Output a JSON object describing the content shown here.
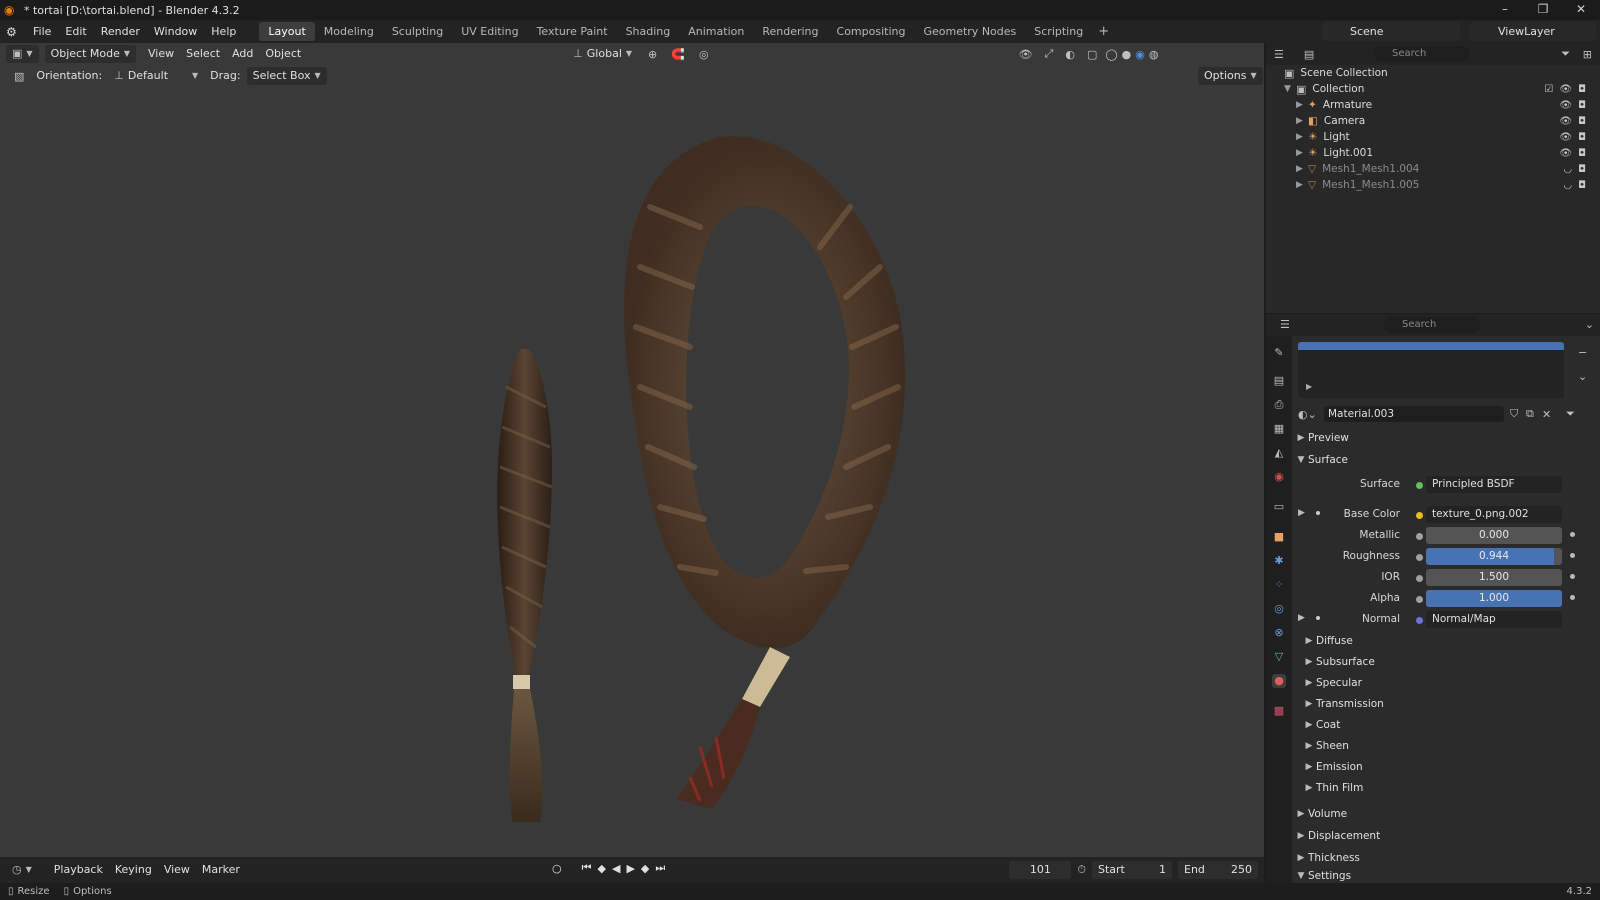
{
  "window": {
    "title": "* tortai [D:\\tortai.blend] - Blender 4.3.2",
    "minimize": "–",
    "maximize": "❐",
    "close": "✕"
  },
  "menu": [
    "File",
    "Edit",
    "Render",
    "Window",
    "Help"
  ],
  "workspaces": {
    "tabs": [
      "Layout",
      "Modeling",
      "Sculpting",
      "UV Editing",
      "Texture Paint",
      "Shading",
      "Animation",
      "Rendering",
      "Compositing",
      "Geometry Nodes",
      "Scripting"
    ],
    "active": "Layout",
    "add": "+"
  },
  "scene": {
    "label": "Scene"
  },
  "view_layer": {
    "label": "ViewLayer"
  },
  "viewport": {
    "mode": "Object Mode",
    "menus": [
      "View",
      "Select",
      "Add",
      "Object"
    ],
    "transform_orientation": "Global",
    "options": "Options",
    "orientation_label": "Orientation:",
    "orientation_value": "Default",
    "drag_label": "Drag:",
    "drag_value": "Select Box"
  },
  "timeline": {
    "menus": [
      "Playback",
      "Keying",
      "View",
      "Marker"
    ],
    "current_frame": "101",
    "start_label": "Start",
    "start_value": "1",
    "end_label": "End",
    "end_value": "250"
  },
  "statusbar": {
    "left1": "Resize",
    "left2": "Options",
    "version": "4.3.2"
  },
  "outliner": {
    "search_placeholder": "Search",
    "root": "Scene Collection",
    "collection": "Collection",
    "items": [
      {
        "name": "Armature",
        "icon": "armature-icon",
        "enabled": true
      },
      {
        "name": "Camera",
        "icon": "camera-icon",
        "enabled": true
      },
      {
        "name": "Light",
        "icon": "light-icon",
        "enabled": true
      },
      {
        "name": "Light.001",
        "icon": "light-icon",
        "enabled": true
      },
      {
        "name": "Mesh1_Mesh1.004",
        "icon": "mesh-icon",
        "enabled": false
      },
      {
        "name": "Mesh1_Mesh1.005",
        "icon": "mesh-icon",
        "enabled": false
      }
    ]
  },
  "properties": {
    "search_placeholder": "Search",
    "material_name": "Material.003",
    "panels": {
      "preview": "Preview",
      "surface": "Surface",
      "volume": "Volume",
      "displacement": "Displacement",
      "thickness": "Thickness",
      "settings": "Settings"
    },
    "surface_shader_label": "Surface",
    "surface_shader": "Principled BSDF",
    "inputs": {
      "base_color": {
        "label": "Base Color",
        "value": "texture_0.png.002"
      },
      "metallic": {
        "label": "Metallic",
        "value": "0.000",
        "fraction": 0.0
      },
      "roughness": {
        "label": "Roughness",
        "value": "0.944",
        "fraction": 0.944
      },
      "ior": {
        "label": "IOR",
        "value": "1.500",
        "fraction": 0.0
      },
      "alpha": {
        "label": "Alpha",
        "value": "1.000",
        "fraction": 1.0
      },
      "normal": {
        "label": "Normal",
        "value": "Normal/Map"
      }
    },
    "subpanels": [
      "Diffuse",
      "Subsurface",
      "Specular",
      "Transmission",
      "Coat",
      "Sheen",
      "Emission",
      "Thin Film"
    ]
  },
  "colors": {
    "accent": "#4772b3",
    "viewport_bg": "#393939",
    "active_tab": "#3d3d3d"
  }
}
